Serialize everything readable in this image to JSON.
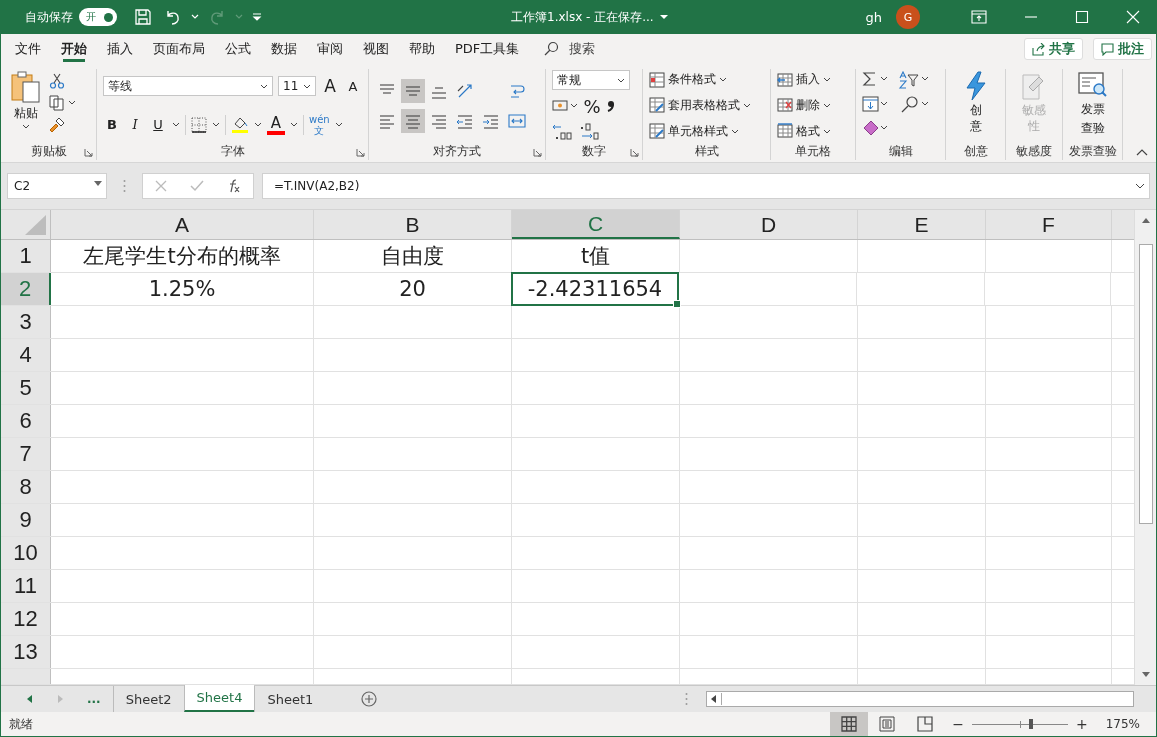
{
  "title_bar": {
    "autosave_label": "自动保存",
    "autosave_toggle": {
      "label": "开",
      "on": true
    },
    "file_title": "工作簿1.xlsx - 正在保存...",
    "user": "gh",
    "avatar_initial": "G"
  },
  "menu_tabs": [
    {
      "label": "文件",
      "selected": false
    },
    {
      "label": "开始",
      "selected": true
    },
    {
      "label": "插入",
      "selected": false
    },
    {
      "label": "页面布局",
      "selected": false
    },
    {
      "label": "公式",
      "selected": false
    },
    {
      "label": "数据",
      "selected": false
    },
    {
      "label": "审阅",
      "selected": false
    },
    {
      "label": "视图",
      "selected": false
    },
    {
      "label": "帮助",
      "selected": false
    },
    {
      "label": "PDF工具集",
      "selected": false
    }
  ],
  "search": {
    "placeholder": "搜索"
  },
  "share_button": "共享",
  "comments_button": "批注",
  "ribbon": {
    "clipboard": {
      "label": "剪贴板",
      "paste": "粘贴"
    },
    "font": {
      "label": "字体",
      "font_name": "等线",
      "font_size": "11",
      "grow": "A",
      "shrink": "A",
      "bold": "B",
      "italic": "I",
      "underline": "U",
      "font_color": "A",
      "phonetic_top": "wén",
      "phonetic_bottom": "文"
    },
    "alignment": {
      "label": "对齐方式",
      "buttons": [
        {
          "kind": "top",
          "selected": false
        },
        {
          "kind": "middle",
          "selected": true
        },
        {
          "kind": "bottom",
          "selected": false
        },
        {
          "kind": "orientation",
          "selected": false
        },
        {
          "kind": "wrap",
          "selected": false
        },
        {
          "kind": "left",
          "selected": false
        },
        {
          "kind": "center",
          "selected": true
        },
        {
          "kind": "right",
          "selected": false
        },
        {
          "kind": "outdent",
          "selected": false
        },
        {
          "kind": "indent",
          "selected": false
        },
        {
          "kind": "merge",
          "selected": false
        }
      ]
    },
    "number": {
      "label": "数字",
      "format": "常规",
      "percent": "%"
    },
    "styles": {
      "label": "样式",
      "items": [
        "条件格式",
        "套用表格格式",
        "单元格样式"
      ]
    },
    "cells": {
      "label": "单元格",
      "items": [
        "插入",
        "删除",
        "格式"
      ]
    },
    "editing": {
      "label": "编辑"
    },
    "ideas": {
      "label": "创意",
      "button": "创意"
    },
    "sensitivity": {
      "label": "敏感度",
      "button": "敏感性",
      "disabled": true
    },
    "invoice": {
      "label": "发票查验",
      "button_top": "发票",
      "button_bottom": "查验"
    }
  },
  "formula_bar": {
    "name_box": "C2",
    "formula": "=T.INV(A2,B2)"
  },
  "sheet": {
    "columns": [
      {
        "label": "A",
        "selected": false
      },
      {
        "label": "B",
        "selected": false
      },
      {
        "label": "C",
        "selected": true
      },
      {
        "label": "D",
        "selected": false
      },
      {
        "label": "E",
        "selected": false
      },
      {
        "label": "F",
        "selected": false
      }
    ],
    "rows": [
      {
        "label": "1",
        "selected": false,
        "cells": [
          {
            "text": "左尾学生t分布的概率",
            "selected": false
          },
          {
            "text": "自由度",
            "selected": false
          },
          {
            "text": "t值",
            "selected": false
          }
        ]
      },
      {
        "label": "2",
        "selected": true,
        "cells": [
          {
            "text": "1.25%",
            "selected": false
          },
          {
            "text": "20",
            "selected": false
          },
          {
            "text": "-2.42311654",
            "selected": true
          }
        ]
      },
      {
        "label": "3",
        "selected": false
      },
      {
        "label": "4",
        "selected": false
      },
      {
        "label": "5",
        "selected": false
      },
      {
        "label": "6",
        "selected": false
      },
      {
        "label": "7",
        "selected": false
      },
      {
        "label": "8",
        "selected": false
      },
      {
        "label": "9",
        "selected": false
      },
      {
        "label": "10",
        "selected": false
      },
      {
        "label": "11",
        "selected": false
      },
      {
        "label": "12",
        "selected": false
      },
      {
        "label": "13",
        "selected": false
      }
    ]
  },
  "sheet_tabs": {
    "more": "...",
    "tabs": [
      {
        "label": "Sheet2",
        "selected": false
      },
      {
        "label": "Sheet4",
        "selected": true
      },
      {
        "label": "Sheet1",
        "selected": false
      }
    ]
  },
  "status_bar": {
    "status": "就绪",
    "views": [
      {
        "kind": "normal",
        "selected": true
      },
      {
        "kind": "page_layout",
        "selected": false
      },
      {
        "kind": "page_break",
        "selected": false
      }
    ],
    "zoom_out": "−",
    "zoom_in": "+",
    "zoom": {
      "level": 0.62
    },
    "zoom_text": "175%"
  }
}
